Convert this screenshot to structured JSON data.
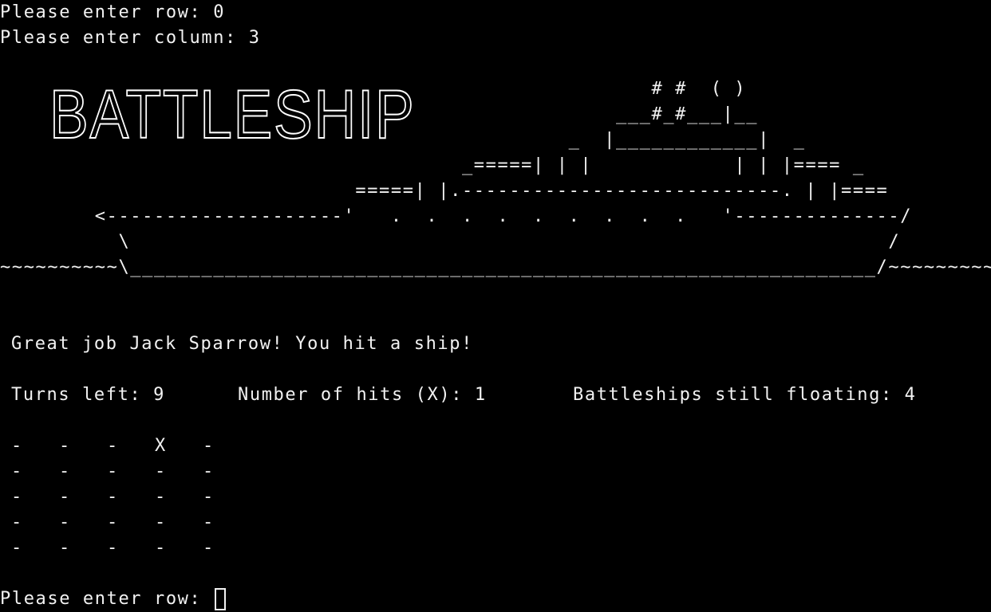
{
  "history": {
    "row_prompt": "Please enter row: 0",
    "column_prompt": "Please enter column: 3"
  },
  "title_art": "BATTLESHIP",
  "ship_art": "                                                       # #  ( )\n                                                    ___#_#___|__\n                                                _  |____________|  _\n                                       _=====| | |            | | |==== _\n                              =====| |.---------------------------. | |====\n        <--------------------'   .  .  .  .  .  .  .  .  .   '--------------/\n          \\                                                                /\n~~~~~~~~~~\\_______________________________________________________________/~~~~~~~~~~",
  "message": "Great job Jack Sparrow! You hit a ship!",
  "stats": {
    "turns_left": "Turns left: 9",
    "hits": "Number of hits (X): 1",
    "ships_floating": "Battleships still floating: 4"
  },
  "board": [
    [
      "-",
      "-",
      "-",
      "X",
      "-"
    ],
    [
      "-",
      "-",
      "-",
      "-",
      "-"
    ],
    [
      "-",
      "-",
      "-",
      "-",
      "-"
    ],
    [
      "-",
      "-",
      "-",
      "-",
      "-"
    ],
    [
      "-",
      "-",
      "-",
      "-",
      "-"
    ]
  ],
  "current_prompt": "Please enter row: "
}
